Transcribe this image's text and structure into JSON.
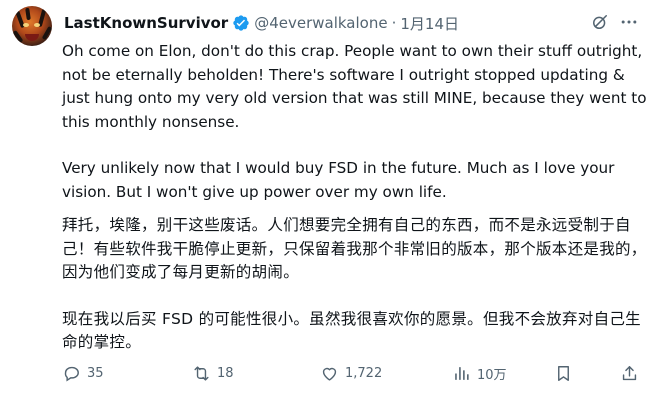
{
  "tweet": {
    "display_name": "LastKnownSurvivor",
    "handle": "@4everwalkalone",
    "separator": "·",
    "date": "1月14日",
    "en_paragraph_1": "Oh come on Elon, don't do this crap. People want to own their stuff outright, not be eternally beholden! There's software I outright stopped updating & just hung onto my very old version that was still MINE, because they went to this monthly nonsense.",
    "en_paragraph_2": "Very unlikely now that I would buy FSD in the future. Much as I love your vision. But I won't give up power over my own life.",
    "zh_paragraph_1": "拜托，埃隆，别干这些废话。人们想要完全拥有自己的东西，而不是永远受制于自己！有些软件我干脆停止更新，只保留着我那个非常旧的版本，那个版本还是我的，因为他们变成了每月更新的胡闹。",
    "zh_paragraph_2": "现在我以后买 FSD 的可能性很小。虽然我很喜欢你的愿景。但我不会放弃对自己生命的掌控。"
  },
  "actions": {
    "replies": "35",
    "reposts": "18",
    "likes": "1,722",
    "views": "10万"
  },
  "icons": {
    "verified": "verified-badge-icon",
    "grok": "grok-icon",
    "more": "more-icon",
    "reply": "reply-icon",
    "repost": "repost-icon",
    "like": "heart-icon",
    "views": "views-chart-icon",
    "bookmark": "bookmark-icon",
    "share": "share-icon"
  },
  "colors": {
    "text": "#0f1419",
    "muted": "#536471",
    "verified": "#1d9bf0"
  }
}
